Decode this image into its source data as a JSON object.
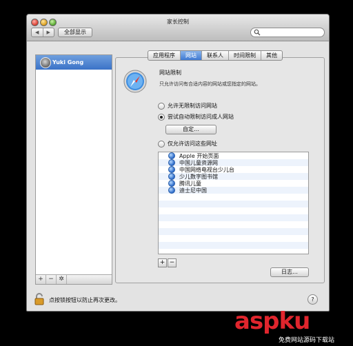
{
  "window": {
    "title": "家长控制"
  },
  "toolbar": {
    "back_icon": "◀",
    "forward_icon": "▶",
    "show_all": "全部显示",
    "search_placeholder": ""
  },
  "sidebar": {
    "users": [
      {
        "name": "Yuki Gong",
        "selected": true
      }
    ],
    "buttons": {
      "add": "+",
      "remove": "−",
      "gear": "✲"
    }
  },
  "tabs": [
    {
      "label": "应用程序",
      "active": false
    },
    {
      "label": "网站",
      "active": true
    },
    {
      "label": "联系人",
      "active": false
    },
    {
      "label": "时间限制",
      "active": false
    },
    {
      "label": "其他",
      "active": false
    }
  ],
  "section": {
    "title": "网站限制",
    "description": "只允许访问有合适内容的网站或您指定的网站。"
  },
  "options": {
    "unlimited": "允许无限制访问网站",
    "auto_limit": "尝试自动限制访问成人网站",
    "custom_button": "自定…",
    "only_these": "仅允许访问这些网址",
    "selected": "auto_limit"
  },
  "sites": [
    "Apple 开始页面",
    "中国儿童资源网",
    "中国网络电视台少儿台",
    "少儿数字图书馆",
    "腾讯儿童",
    "迪士尼中国"
  ],
  "list_buttons": {
    "add": "+",
    "remove": "−"
  },
  "log_button": "日志…",
  "footer": {
    "lock_text": "点按锁按钮以防止再次更改。",
    "help": "?"
  },
  "watermark": {
    "logo": "aspku",
    "sub": "免费网站源码下载站"
  }
}
